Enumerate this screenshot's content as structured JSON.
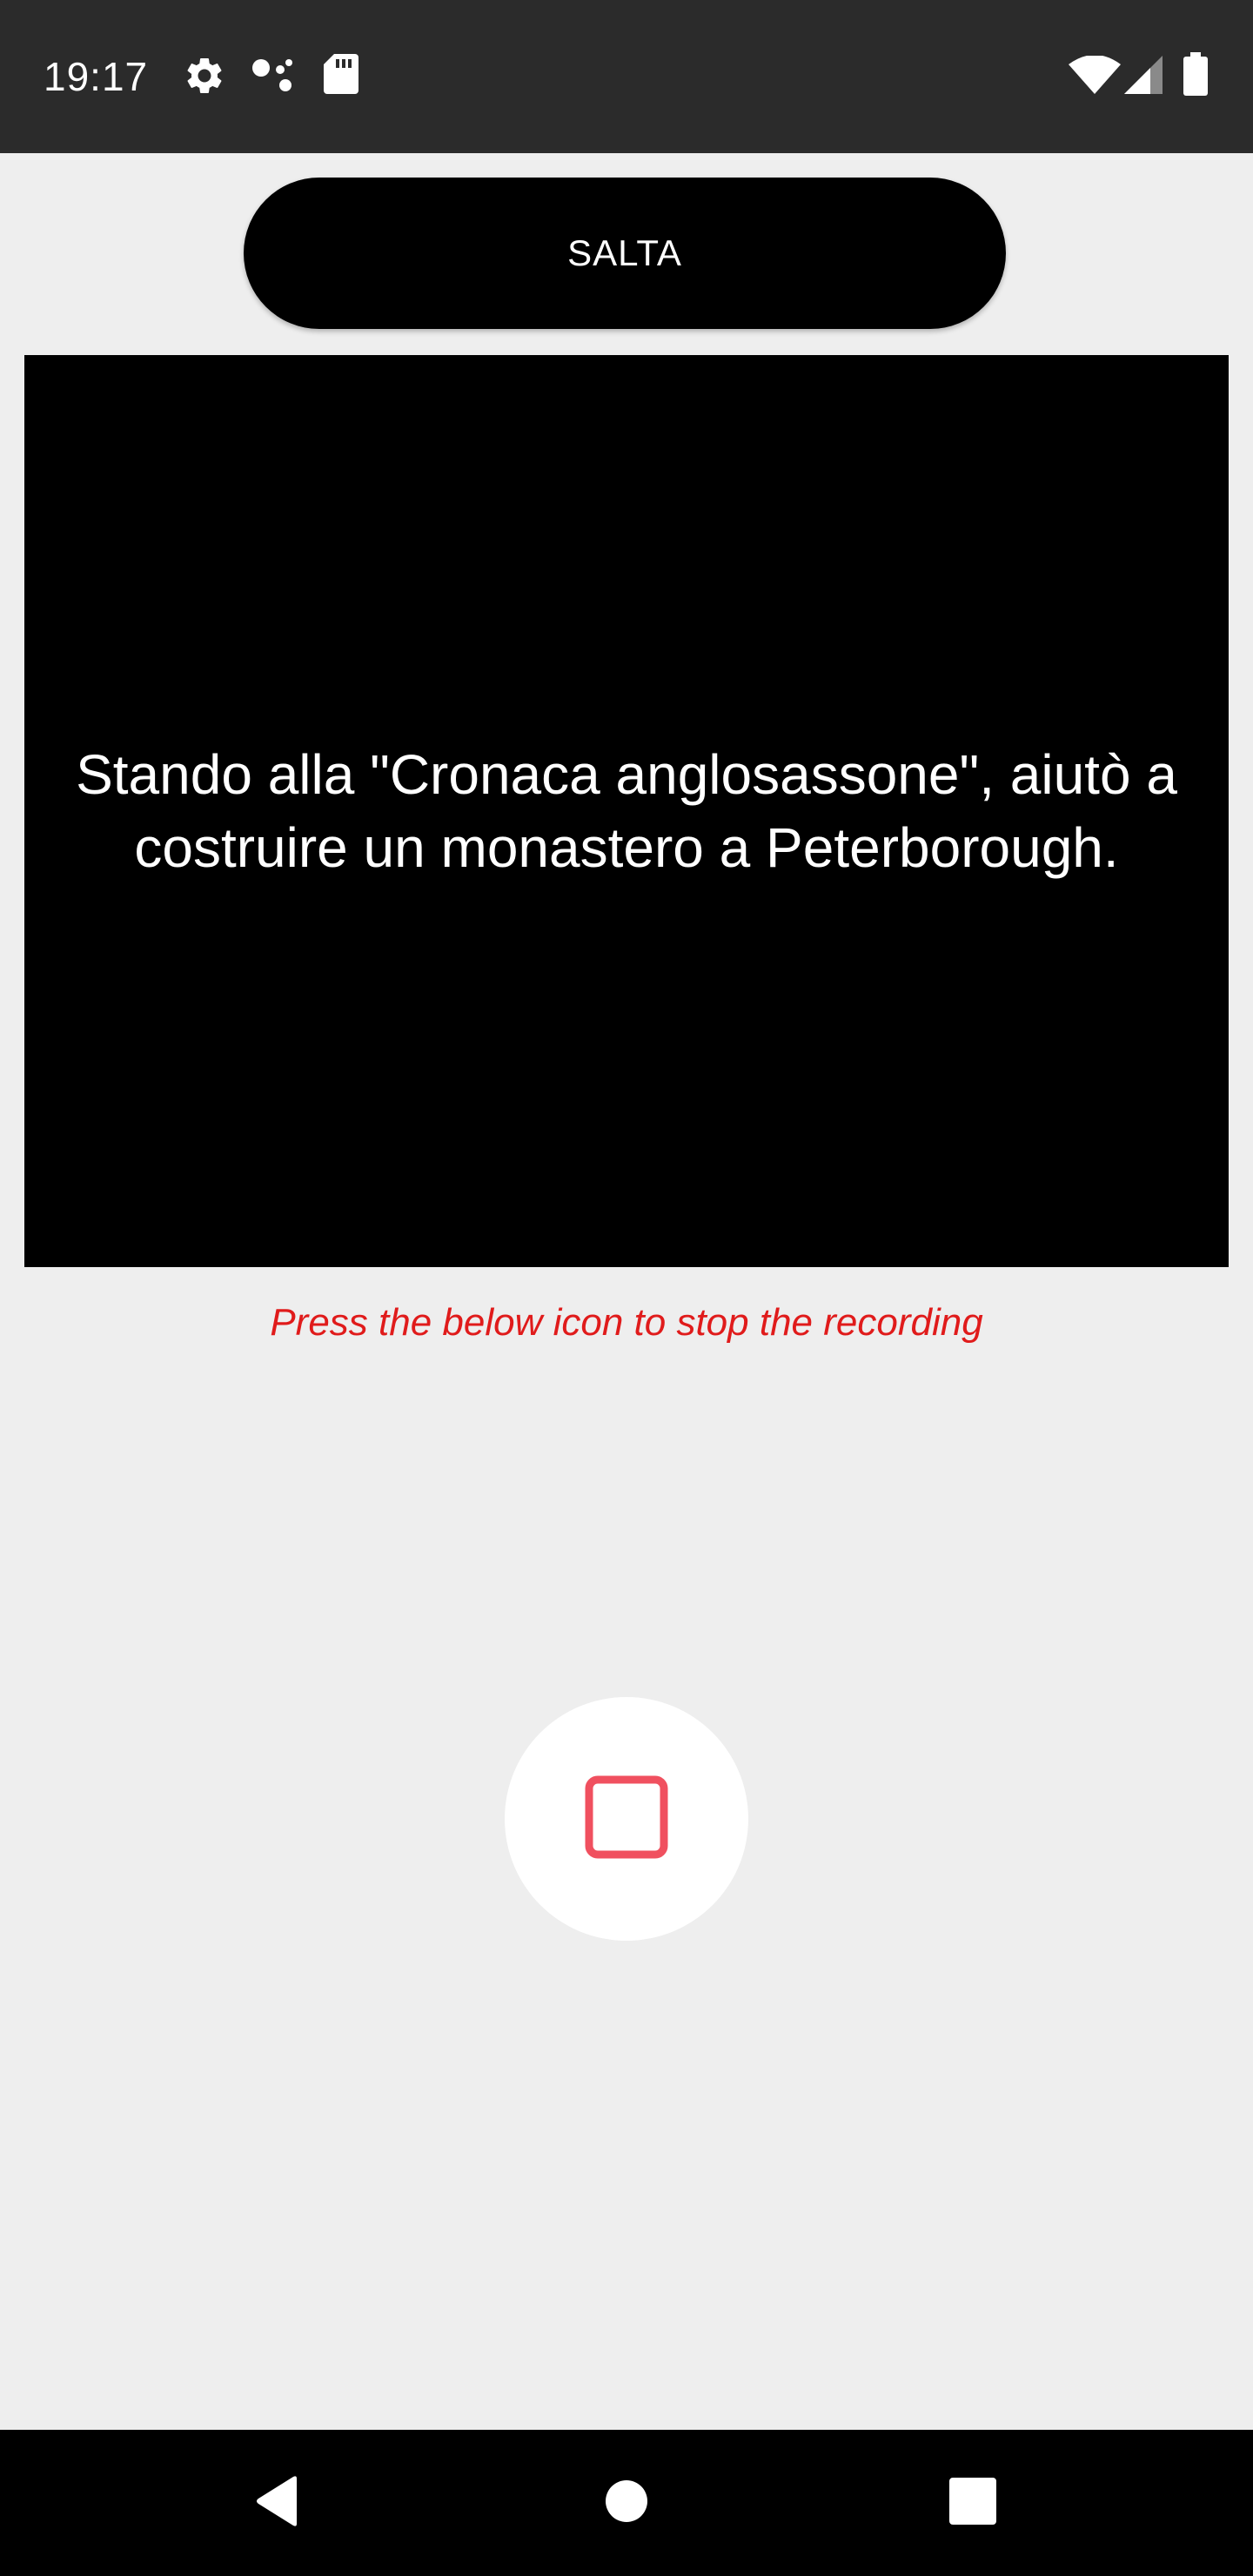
{
  "status_bar": {
    "time": "19:17",
    "left_icons": [
      "gear-icon",
      "assistant-dots-icon",
      "sd-card-icon"
    ],
    "right_icons": [
      "wifi-icon",
      "signal-icon",
      "battery-icon"
    ]
  },
  "skip_button": {
    "label": "SALTA"
  },
  "prompt": {
    "text": "Stando alla \"Cronaca anglosassone\", aiutò a costruire un monastero a Peterborough."
  },
  "instruction": {
    "text": "Press the below icon to stop the recording",
    "color": "#e01b1b"
  },
  "stop_button": {
    "icon": "stop-square-icon",
    "icon_color": "#f0505f"
  },
  "nav_bar": {
    "icons": [
      "back-icon",
      "home-icon",
      "recents-icon"
    ]
  }
}
